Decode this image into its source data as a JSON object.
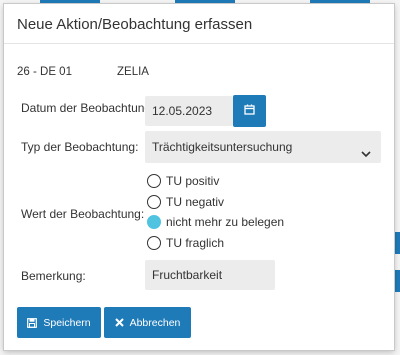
{
  "modal": {
    "title": "Neue Aktion/Beobachtung erfassen"
  },
  "animal": {
    "id": "26 - DE 01",
    "name": "ZELIA"
  },
  "form": {
    "date_label": "Datum der Beobachtung:",
    "date_value": "12.05.2023",
    "type_label": "Typ der Beobachtung:",
    "type_value": "Trächtigkeitsuntersuchung",
    "value_label": "Wert der Beobachtung:",
    "options": [
      {
        "label": "TU positiv",
        "checked": false
      },
      {
        "label": "TU negativ",
        "checked": false
      },
      {
        "label": "nicht mehr zu belegen",
        "checked": true
      },
      {
        "label": "TU fraglich",
        "checked": false
      }
    ],
    "remark_label": "Bemerkung:",
    "remark_value": "Fruchtbarkeit"
  },
  "buttons": {
    "save_label": "Speichern",
    "cancel_label": "Abbrechen"
  },
  "colors": {
    "accent": "#1f7ab8",
    "radio_checked": "#4fc3e0",
    "input_bg": "#ececec"
  },
  "icons": {
    "calendar": "calendar-icon",
    "chevron": "chevron-down-icon",
    "save": "save-icon",
    "cancel": "close-icon"
  }
}
